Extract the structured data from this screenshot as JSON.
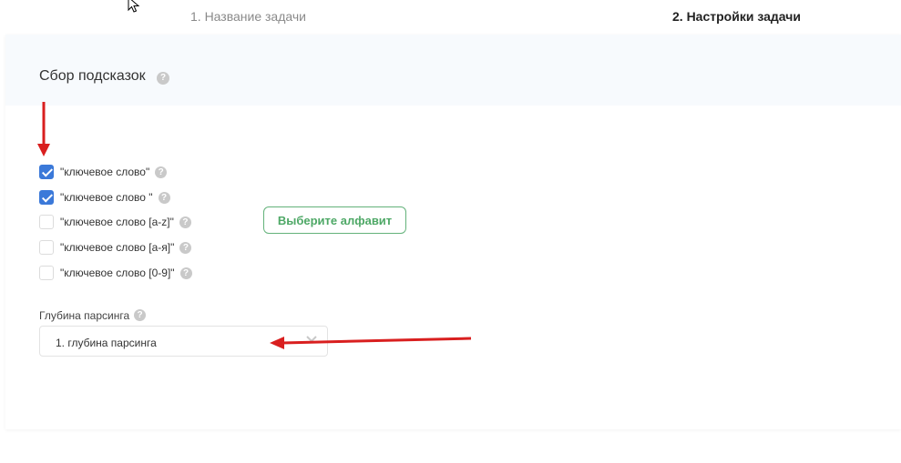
{
  "steps": {
    "step1": "1. Название задачи",
    "step2": "2. Настройки задачи"
  },
  "section": {
    "title": "Сбор подсказок",
    "help_icon": "question-icon"
  },
  "options": [
    {
      "label": "\"ключевое слово\"",
      "checked": true
    },
    {
      "label": "\"ключевое слово \"",
      "checked": true
    },
    {
      "label": "\"ключевое слово [a-z]\"",
      "checked": false
    },
    {
      "label": "\"ключевое слово [а-я]\"",
      "checked": false
    },
    {
      "label": "\"ключевое слово [0-9]\"",
      "checked": false
    }
  ],
  "alphabet_button": "Выберите алфавит",
  "depth": {
    "label": "Глубина парсинга",
    "selected": "1. глубина парсинга"
  },
  "colors": {
    "accent_blue": "#3b79d9",
    "button_green": "#4ea866",
    "annotation_red": "#d91f1f"
  }
}
